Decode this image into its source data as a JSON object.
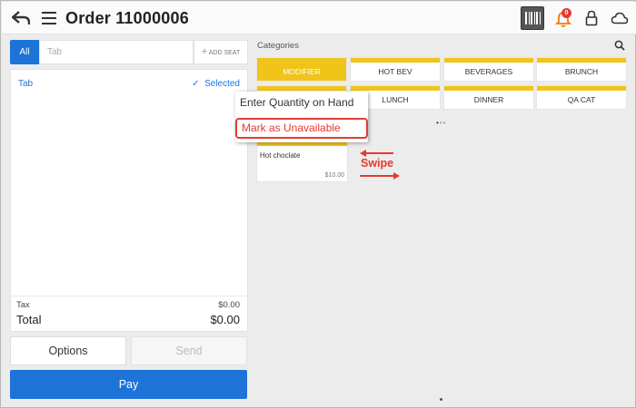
{
  "header": {
    "title": "Order 11000006",
    "notification_count": "0",
    "icons": [
      "back-arrow-icon",
      "hamburger-menu-icon",
      "barcode-icon",
      "bell-icon",
      "lock-icon",
      "cloud-icon"
    ]
  },
  "ticket": {
    "tabs": {
      "all_label": "All",
      "tab_placeholder": "Tab",
      "add_seat_label": "ADD SEAT",
      "add_seat_plus": "+"
    },
    "tab_name": "Tab",
    "selected_label": "Selected",
    "selected_check": "✓",
    "tax_label": "Tax",
    "tax_value": "$0.00",
    "total_label": "Total",
    "total_value": "$0.00"
  },
  "actions": {
    "options_label": "Options",
    "send_label": "Send",
    "pay_label": "Pay"
  },
  "categories": {
    "header": "Categories",
    "row1": [
      {
        "label": "MODIFIER",
        "active": true
      },
      {
        "label": "HOT BEV"
      },
      {
        "label": "BEVERAGES"
      },
      {
        "label": "BRUNCH"
      }
    ],
    "row2": [
      {
        "label": ""
      },
      {
        "label": "LUNCH"
      },
      {
        "label": "DINNER"
      },
      {
        "label": "QA CAT"
      }
    ],
    "pager": {
      "active": "•",
      "inactive": "••"
    }
  },
  "items": [
    {
      "name": "Hot choclate",
      "price": "$10.00"
    }
  ],
  "popup": {
    "enter_quantity": "Enter Quantity on Hand",
    "mark_unavailable": "Mark as Unavailable"
  },
  "annotation": {
    "swipe_label": "Swipe"
  },
  "colors": {
    "accent_blue": "#1e73d8",
    "category_yellow": "#f0c419",
    "annotation_red": "#e53935"
  }
}
